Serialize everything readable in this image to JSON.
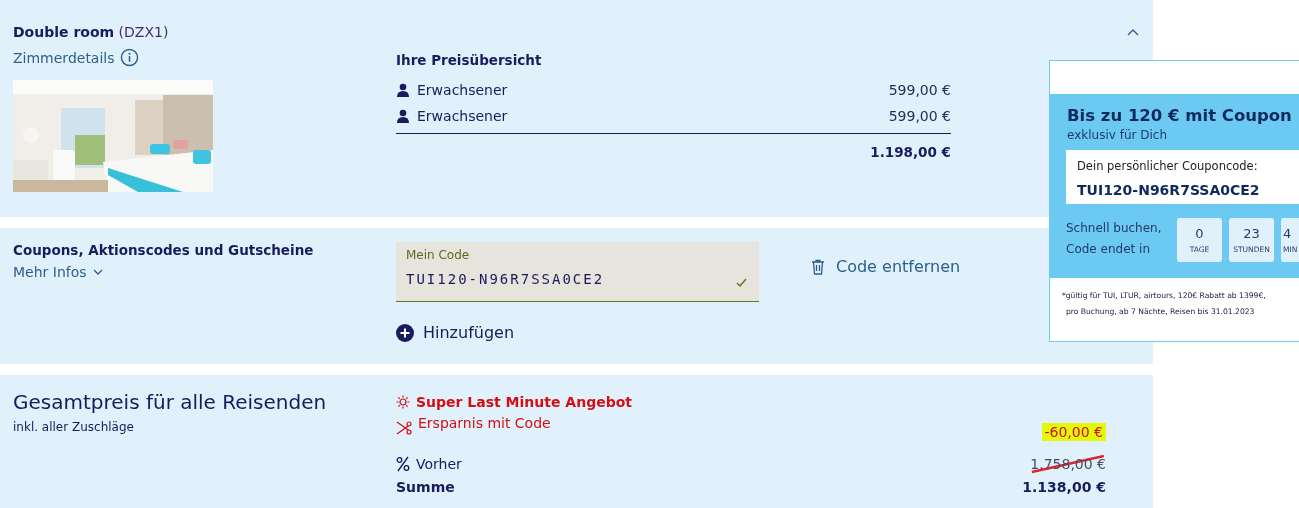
{
  "room": {
    "title": "Double room",
    "code": "(DZX1)",
    "details_link": "Zimmerdetails",
    "expanded": true,
    "price_overview": {
      "title": "Ihre Preisübersicht",
      "lines": [
        {
          "label": "Erwachsener",
          "price": "599,00 €"
        },
        {
          "label": "Erwachsener",
          "price": "599,00 €"
        }
      ],
      "total": "1.198,00 €"
    }
  },
  "coupons": {
    "title": "Coupons, Aktionscodes und Gutscheine",
    "more_info": "Mehr Infos",
    "code_field": {
      "label": "Mein Code",
      "value": "TUI120-N96R7SSA0CE2",
      "valid": true
    },
    "remove_button": "Code entfernen",
    "add_button": "Hinzufügen"
  },
  "total": {
    "title": "Gesamtpreis für alle Reisenden",
    "subtitle": "inkl. aller Zuschläge",
    "lines": [
      {
        "kind": "offer",
        "label": "Super Last Minute Angebot"
      },
      {
        "kind": "saving",
        "label": "Ersparnis mit Code",
        "amount": "-60,00 €"
      },
      {
        "kind": "before",
        "label": "Vorher",
        "amount": "1.758,00 €"
      },
      {
        "kind": "sum",
        "label": "Summe",
        "amount": "1.138,00 €"
      }
    ]
  },
  "coupon_popup": {
    "title": "Bis zu 120 € mit Coupon",
    "subtitle": "exklusiv für Dich",
    "code_label": "Dein persönlicher Couponcode:",
    "code": "TUI120-N96R7SSA0CE2",
    "countdown_label": "Schnell buchen, Code endet in",
    "countdown": [
      {
        "value": "0",
        "unit": "TAGE"
      },
      {
        "value": "23",
        "unit": "STUNDEN"
      },
      {
        "value": "4",
        "unit": "MIN"
      }
    ],
    "footnote": [
      "*gültig für TUI, LTUR, airtours, 120€ Rabatt ab 1399€,",
      "pro Buchung, ab 7 Nächte, Reisen bis 31.01.2023"
    ]
  }
}
